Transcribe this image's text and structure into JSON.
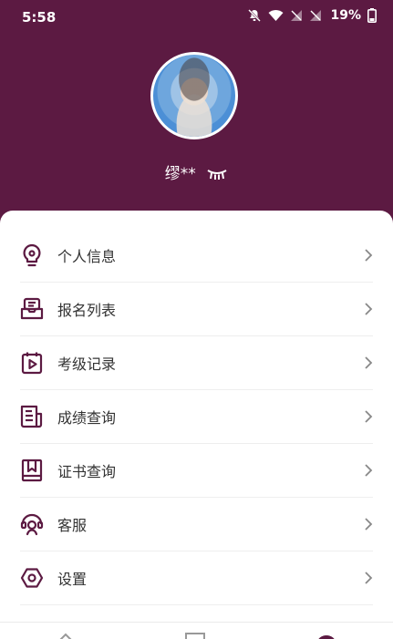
{
  "status_bar": {
    "time": "5:58",
    "battery": "19%"
  },
  "profile": {
    "name": "缪**"
  },
  "menu": [
    {
      "label": "个人信息",
      "icon": "lightbulb-icon"
    },
    {
      "label": "报名列表",
      "icon": "inbox-icon"
    },
    {
      "label": "考级记录",
      "icon": "calendar-play-icon"
    },
    {
      "label": "成绩查询",
      "icon": "document-icon"
    },
    {
      "label": "证书查询",
      "icon": "certificate-icon"
    },
    {
      "label": "客服",
      "icon": "customer-service-icon"
    },
    {
      "label": "设置",
      "icon": "hexagon-settings-icon"
    }
  ],
  "colors": {
    "brand": "#5c1a42",
    "text": "#333333",
    "chevron": "#888888"
  }
}
